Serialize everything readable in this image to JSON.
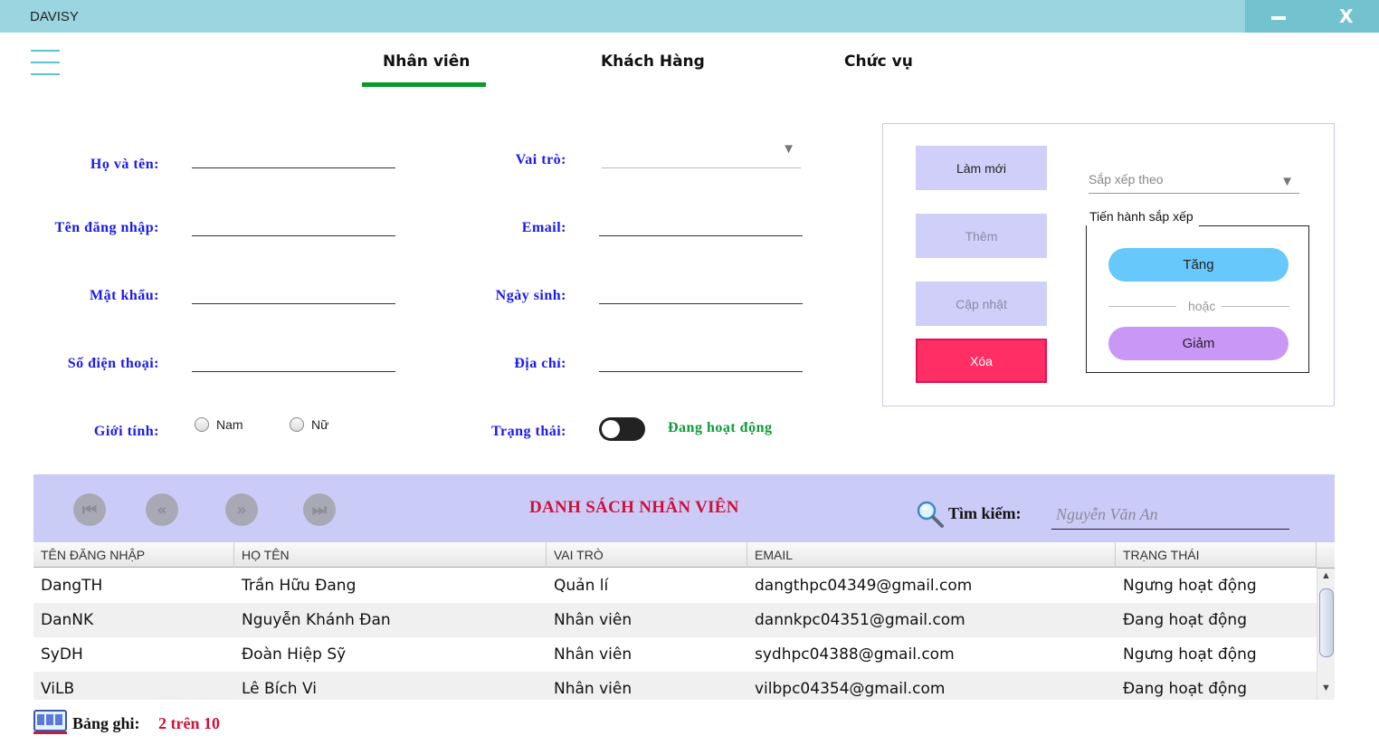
{
  "app": {
    "title": "DAVISY",
    "minimize": "",
    "close": "X"
  },
  "tabs": [
    {
      "label": "Nhân viên",
      "active": true
    },
    {
      "label": "Khách Hàng",
      "active": false
    },
    {
      "label": "Chức vụ",
      "active": false
    }
  ],
  "form": {
    "fullname_label": "Họ và tên:",
    "fullname_value": "",
    "username_label": "Tên đăng nhập:",
    "username_value": "",
    "password_label": "Mật khẩu:",
    "password_value": "",
    "phone_label": "Số điện thoại:",
    "phone_value": "",
    "gender_label": "Giới tính:",
    "gender_options": [
      "Nam",
      "Nữ"
    ],
    "role_label": "Vai trò:",
    "role_value": "",
    "email_label": "Email:",
    "email_value": "",
    "birthdate_label": "Ngày sinh:",
    "birthdate_value": "",
    "address_label": "Địa chỉ:",
    "address_value": "",
    "status_label": "Trạng thái:",
    "status_text": "Đang hoạt động"
  },
  "actions": {
    "refresh": "Làm mới",
    "add": "Thêm",
    "update": "Cập nhật",
    "delete": "Xóa"
  },
  "sort": {
    "placeholder": "Sắp xếp theo",
    "group_label": "Tiến hành sắp xếp",
    "ascending": "Tăng",
    "separator": "hoặc",
    "descending": "Giảm",
    "ascending_color": "#66c8fb",
    "descending_color": "#c998f7"
  },
  "list": {
    "title": "DANH SÁCH NHÂN VIÊN",
    "search_label": "Tìm kiếm:",
    "search_placeholder": "Nguyễn Văn An",
    "nav": [
      "first",
      "previous",
      "next",
      "last"
    ]
  },
  "table": {
    "columns": [
      "TÊN ĐĂNG NHẬP",
      "HỌ TÊN",
      "VAI TRÒ",
      "EMAIL",
      "TRẠNG THÁI"
    ],
    "rows": [
      [
        "DangTH",
        "Trần Hữu Đang",
        "Quản lí",
        "dangthpc04349@gmail.com",
        "Ngưng hoạt động"
      ],
      [
        "DanNK",
        "Nguyễn Khánh Đan",
        "Nhân viên",
        "dannkpc04351@gmail.com",
        "Đang hoạt động"
      ],
      [
        "SyDH",
        "Đoàn Hiệp Sỹ",
        "Nhân viên",
        "sydhpc04388@gmail.com",
        "Ngưng hoạt động"
      ],
      [
        "ViLB",
        "Lê Bích Vi",
        "Nhân viên",
        "vilbpc04354@gmail.com",
        "Đang hoạt động"
      ]
    ]
  },
  "footer": {
    "record_label": "Bảng ghi:",
    "record_value": "2 trên 10"
  },
  "colors": {
    "titlebar": "#9ad5e0",
    "band": "#cbcbf8",
    "danger": "#ff2f66",
    "active_tab_underline": "#0a9a2a",
    "list_title": "#d0103a",
    "label_blue": "#1a1aee"
  }
}
